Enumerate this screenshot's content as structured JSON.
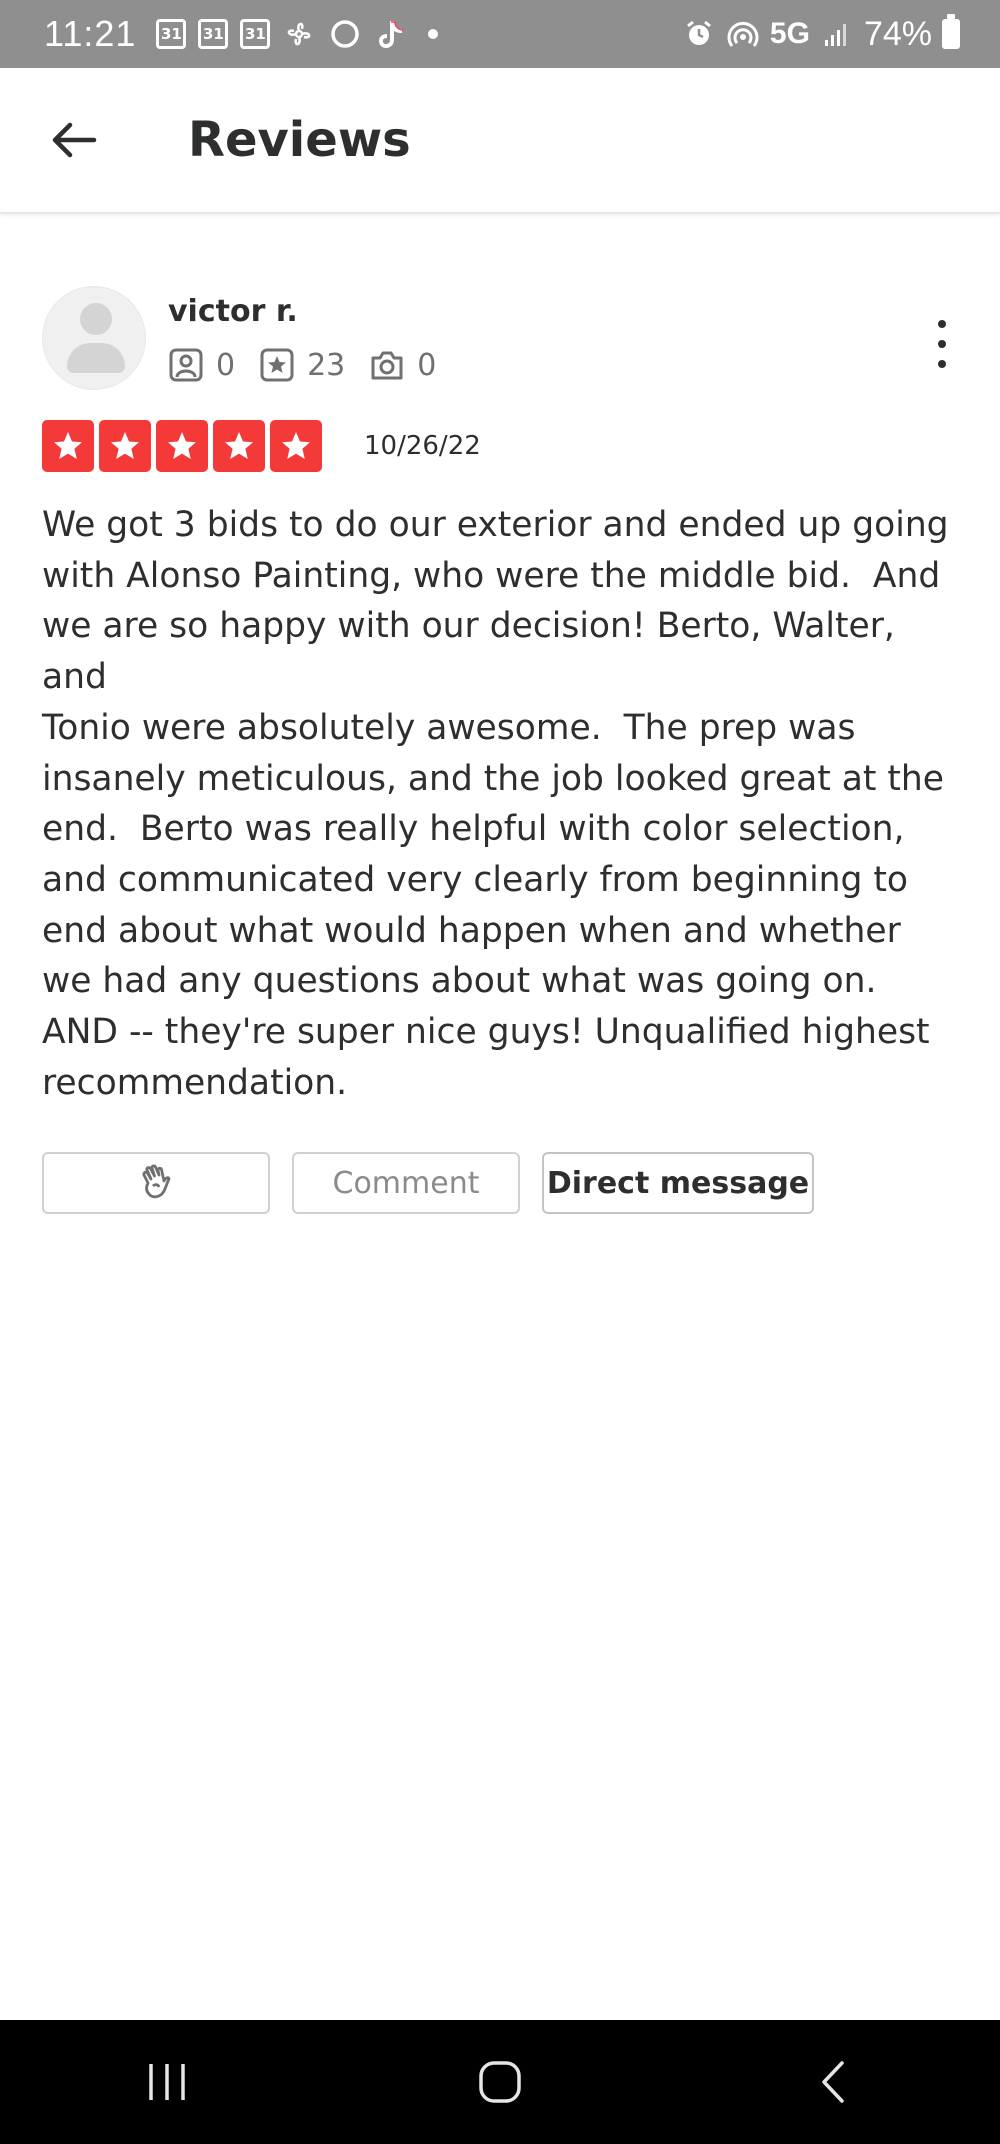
{
  "status_bar": {
    "time": "11:21",
    "calendar_badges": [
      "31",
      "31",
      "31"
    ],
    "network": "5G",
    "battery": "74%"
  },
  "app_bar": {
    "title": "Reviews"
  },
  "review": {
    "user_name": "victor r.",
    "stats": {
      "friends": "0",
      "reviews": "23",
      "photos": "0"
    },
    "rating": 5,
    "date": "10/26/22",
    "text": "We got 3 bids to do our exterior and ended up going\nwith Alonso Painting, who were the middle bid.  And\nwe are so happy with our decision! Berto, Walter, and\nTonio were absolutely awesome.  The prep was\ninsanely meticulous, and the job looked great at the\nend.  Berto was really helpful with color selection,\nand communicated very clearly from beginning to\nend about what would happen when and whether\nwe had any questions about what was going on.\nAND -- they're super nice guys! Unqualified highest\nrecommendation.",
    "actions": {
      "comment_label": "Comment",
      "direct_message_label": "Direct message"
    }
  },
  "colors": {
    "star_red": "#f43939",
    "status_bar_gray": "#8f8f8f",
    "text_dark": "#2d2e2f"
  }
}
